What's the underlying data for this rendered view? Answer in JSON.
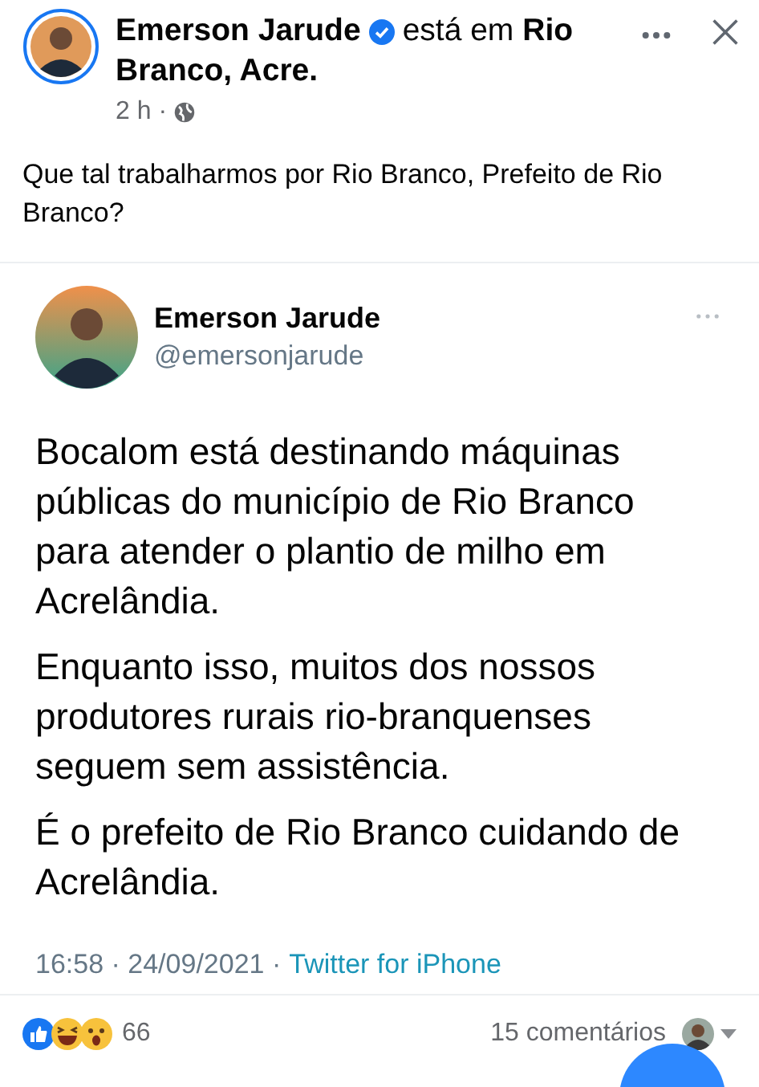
{
  "post": {
    "author": "Emerson Jarude",
    "verified": true,
    "location_lines": [
      "está em **Rio**",
      "**Branco, Acre.**"
    ],
    "time": "2 h ·",
    "caption": "Que tal trabalharmos por Rio Branco, Prefeito de Rio Branco?"
  },
  "tweet": {
    "name": "Emerson Jarude",
    "handle": "@emersonjarude",
    "paragraphs": [
      "Bocalom está destinando máquinas públicas do município de Rio Branco para atender o plantio de milho em Acrelândia.",
      "Enquanto isso, muitos dos nossos produtores rurais rio-branquenses seguem sem assistência.",
      "É o prefeito de Rio Branco cuidando de Acrelândia."
    ],
    "timestamp": "16:58 · 24/09/2021 ·",
    "source": "Twitter for iPhone"
  },
  "reactions": {
    "count": "66",
    "comments": "15 comentários"
  }
}
